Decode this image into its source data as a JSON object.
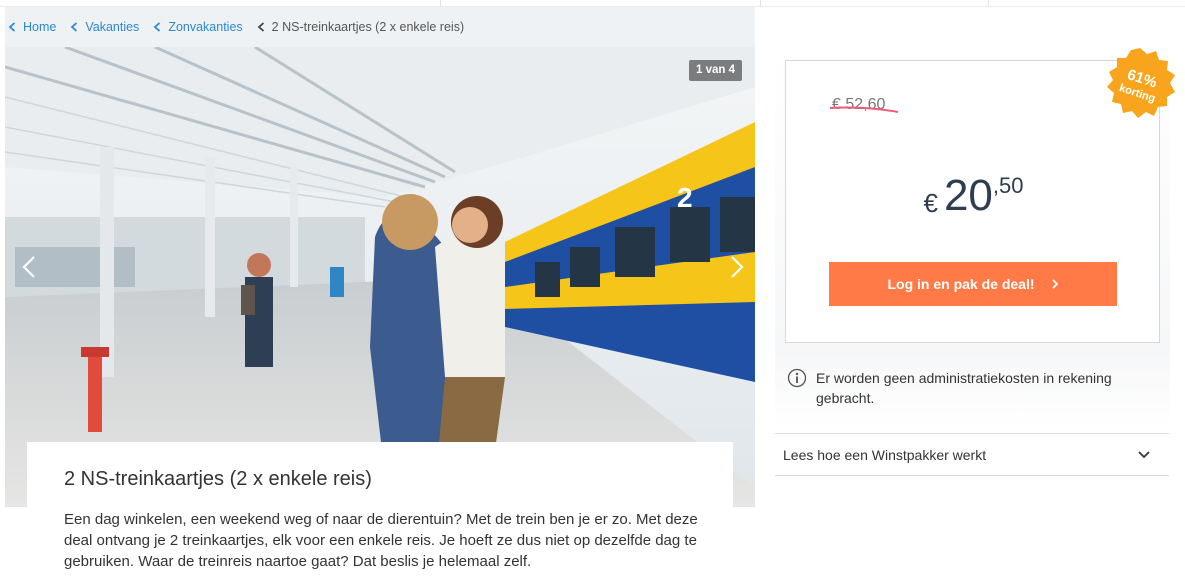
{
  "breadcrumb": [
    {
      "label": "Home"
    },
    {
      "label": "Vakanties"
    },
    {
      "label": "Zonvakanties"
    },
    {
      "label": "2 NS-treinkaartjes (2 x enkele reis)"
    }
  ],
  "gallery": {
    "counter": "1 van 4",
    "current": 1,
    "total": 4
  },
  "deal": {
    "title": "2 NS-treinkaartjes (2 x enkele reis)",
    "description": "Een dag winkelen, een weekend weg of naar de dierentuin? Met de trein ben je er zo. Met deze deal ontvang je 2 treinkaartjes, elk voor een enkele reis. Je hoeft ze dus niet op dezelfde dag te gebruiken. Waar de treinreis naartoe gaat? Dat beslis je helemaal zelf."
  },
  "pricing": {
    "old_price": "€ 52,60",
    "currency": "€",
    "price_main": "20",
    "price_cents": ",50",
    "discount_percent": "61%",
    "discount_label": "korting",
    "cta_label": "Log in en pak de deal!"
  },
  "info": {
    "admin_note": "Er worden geen administratiekosten in rekening gebracht.",
    "how_it_works": "Lees hoe een Winstpakker werkt"
  },
  "colors": {
    "link": "#2d87d0",
    "cta": "#ff7a47",
    "badge": "#f8a51d",
    "price": "#2e3d4f",
    "strike": "#ef5a7a"
  },
  "icons": {
    "breadcrumb_separator": "chevron-left-icon",
    "gallery_prev": "chevron-left-icon",
    "gallery_next": "chevron-right-icon",
    "cta": "chevron-right-icon",
    "info": "info-circle-icon",
    "accordion": "chevron-down-icon"
  }
}
